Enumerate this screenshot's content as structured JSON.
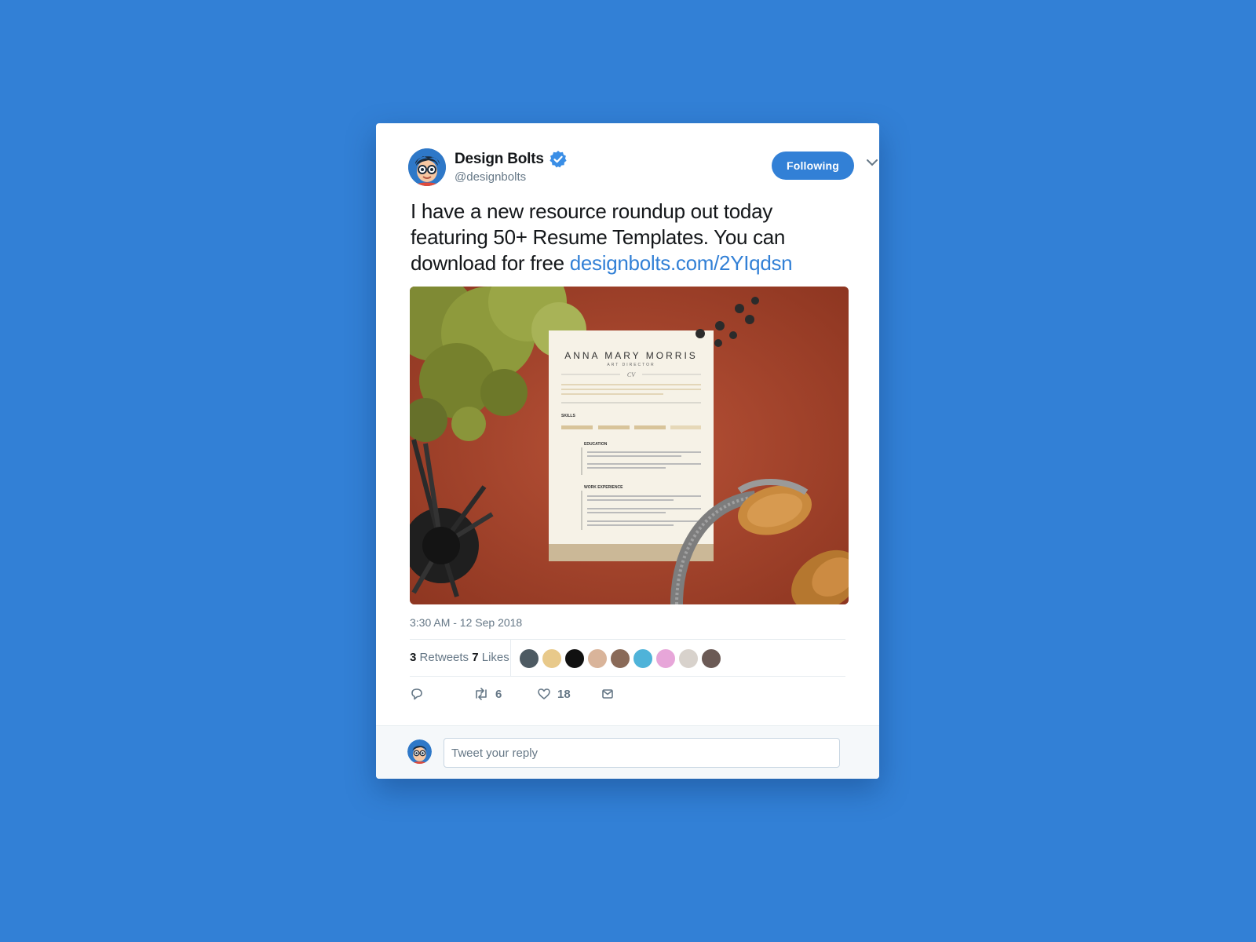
{
  "colors": {
    "background": "#3280d6",
    "accent": "#3280d6",
    "text": "#14171a",
    "muted": "#657786"
  },
  "tweet": {
    "author_name": "Design Bolts",
    "author_handle": "@designbolts",
    "verified_icon": "verified-badge-icon",
    "follow_label": "Following",
    "text": "I have a new resource roundup out today featuring 50+ Resume Templates. You can download for free ",
    "link_text": "designbolts.com/2YIqdsn",
    "timestamp": "3:30 AM - 12 Sep 2018",
    "retweets_count": "3",
    "retweets_label": "Retweets",
    "likes_count": "7",
    "likes_label": "Likes"
  },
  "media": {
    "resume_name": "ANNA MARY MORRIS",
    "resume_role": "ART DIRECTOR",
    "resume_monogram": "CV",
    "resume_sections": [
      "SKILLS",
      "EDUCATION",
      "WORK EXPERIENCE"
    ]
  },
  "actions": {
    "reply_count": "",
    "retweet_count": "6",
    "like_count": "18",
    "icons": [
      "reply-icon",
      "retweet-icon",
      "like-icon",
      "message-icon"
    ]
  },
  "reply": {
    "placeholder": "Tweet your reply"
  }
}
